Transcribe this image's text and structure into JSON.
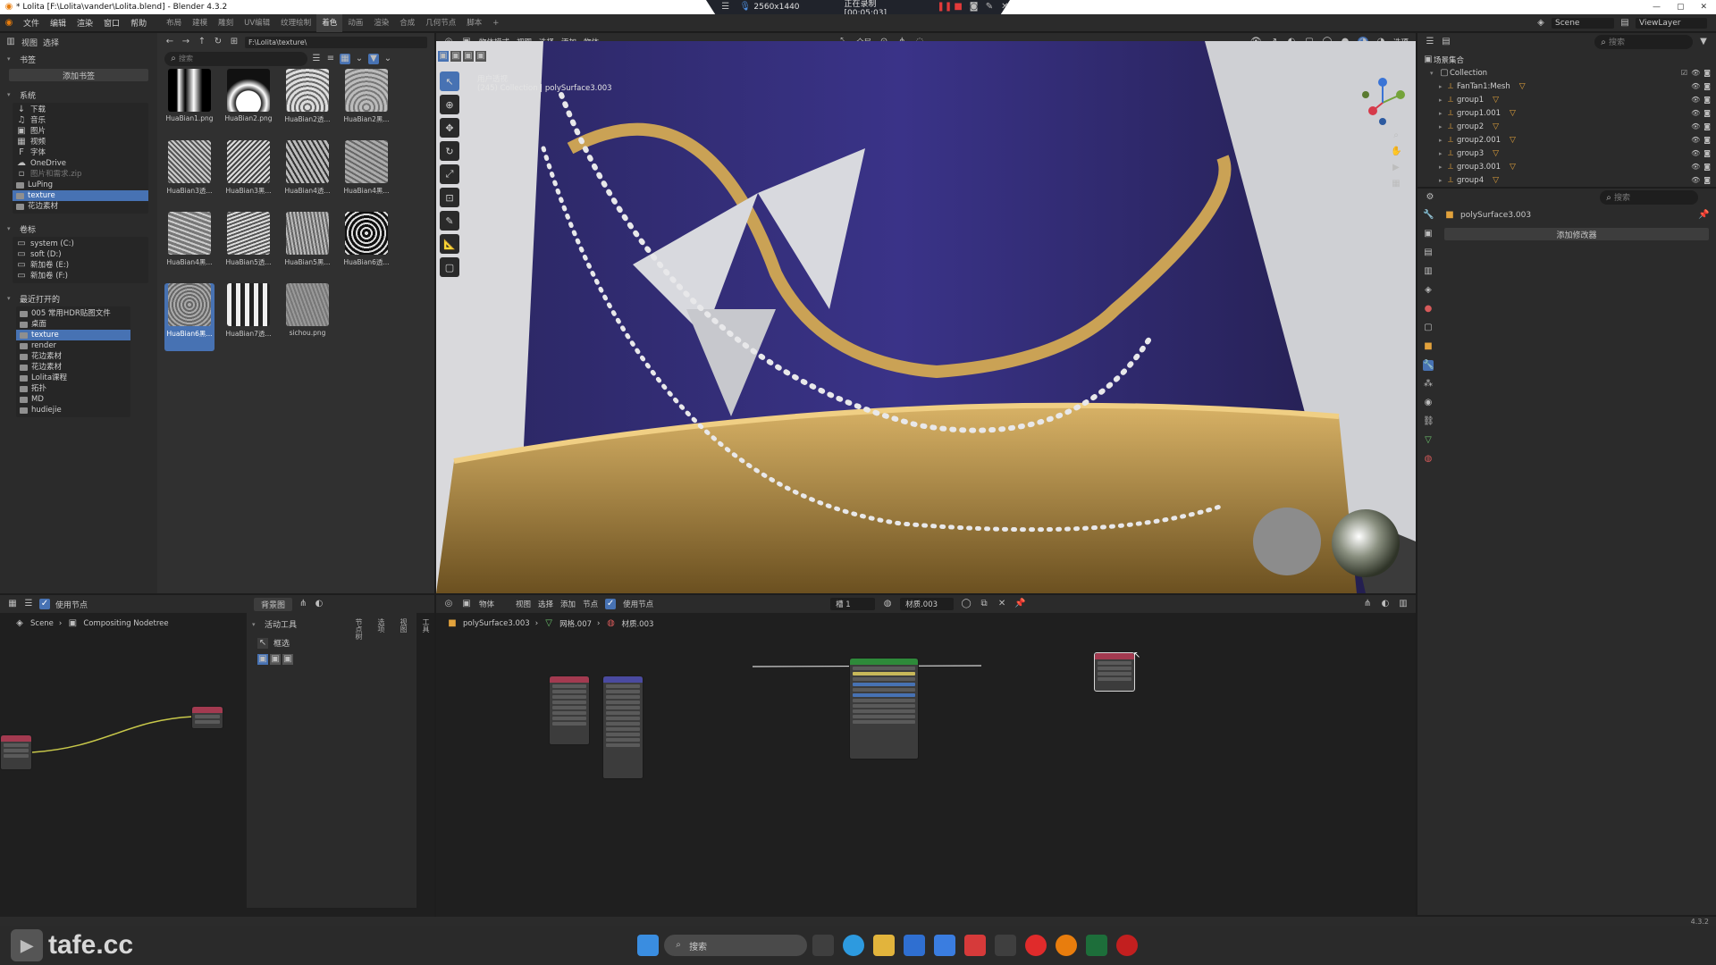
{
  "window": {
    "title": "* Lolita [F:\\Lolita\\vander\\Lolita.blend] - Blender 4.3.2",
    "recording": {
      "resolution": "2560x1440",
      "status": "正在录制 [00:05:03]"
    }
  },
  "menubar": {
    "menus": [
      "文件",
      "编辑",
      "渲染",
      "窗口",
      "帮助"
    ],
    "workspaces": [
      "布局",
      "建模",
      "雕刻",
      "UV编辑",
      "纹理绘制",
      "着色",
      "动画",
      "渲染",
      "合成",
      "几何节点",
      "脚本"
    ],
    "active_workspace": "着色",
    "add_tab": "+",
    "scene": "Scene",
    "view_layer": "ViewLayer"
  },
  "file_browser": {
    "header": {
      "view": "视图",
      "select": "选择"
    },
    "path": "F:\\Lolita\\texture\\",
    "search_placeholder": "搜索",
    "bookmarks_title": "书签",
    "add_bookmark": "添加书签",
    "system_title": "系统",
    "system_items": [
      "下载",
      "音乐",
      "图片",
      "视频",
      "字体",
      "OneDrive",
      "图片和需求.zip",
      "LuPing",
      "texture",
      "花边素材"
    ],
    "system_selected": "texture",
    "volumes_title": "卷标",
    "volumes": [
      "system (C:)",
      "soft (D:)",
      "新加卷 (E:)",
      "新加卷 (F:)"
    ],
    "recent_title": "最近打开的",
    "recent_items": [
      "005 常用HDR贴图文件",
      "桌面",
      "texture",
      "render",
      "花边素材",
      "花边素材",
      "Lolita课程",
      "拓扑",
      "MD",
      "hudiejie"
    ],
    "recent_selected": "texture",
    "files": [
      "HuaBian1.png",
      "HuaBian2.png",
      "HuaBian2透...",
      "HuaBian2黑...",
      "HuaBian3透...",
      "HuaBian3黑...",
      "HuaBian4透...",
      "HuaBian4黑...",
      "HuaBian4黑...",
      "HuaBian5透...",
      "HuaBian5黑...",
      "HuaBian6透...",
      "HuaBian6黑...",
      "HuaBian7透...",
      "sichou.png"
    ],
    "selected_file": "HuaBian6黑..."
  },
  "viewport": {
    "header": {
      "mode": "物体模式",
      "view": "视图",
      "select": "选择",
      "add": "添加",
      "object": "物体",
      "transform": "全局",
      "options": "选项"
    },
    "overlay_title": "用户透视",
    "overlay_info": "(245) Collection | polySurface3.003"
  },
  "outliner": {
    "title": "场景集合",
    "search_placeholder": "搜索",
    "collection": "Collection",
    "items": [
      "FanTan1:Mesh",
      "group1",
      "group1.001",
      "group2",
      "group2.001",
      "group3",
      "group3.001",
      "group4"
    ]
  },
  "properties": {
    "search_placeholder": "搜索",
    "object": "polySurface3.003",
    "add_modifier": "添加修改器"
  },
  "compositor": {
    "use_nodes": "使用节点",
    "backdrop": "背景图",
    "breadcrumb": [
      "Scene",
      "Compositing Nodetree"
    ],
    "active_tool_title": "活动工具",
    "active_tool": "框选",
    "side_tabs": [
      "工具",
      "视图",
      "选项",
      "节点树"
    ]
  },
  "shader_editor": {
    "header": {
      "object": "物体",
      "view": "视图",
      "select": "选择",
      "add": "添加",
      "node": "节点",
      "use_nodes": "使用节点",
      "slot": "槽 1",
      "material": "材质.003"
    },
    "breadcrumb": [
      "polySurface3.003",
      "网格.007",
      "材质.003"
    ]
  },
  "taskbar": {
    "search_placeholder": "搜索"
  },
  "watermark": "tafe.cc",
  "version": "4.3.2"
}
